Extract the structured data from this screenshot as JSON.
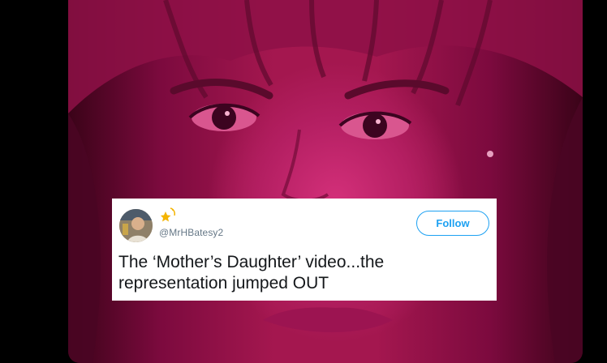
{
  "tweet": {
    "handle": "@MrHBatesy2",
    "follow_label": "Follow",
    "text": "The ‘Mother’s Daughter’ video...the representation jumped OUT",
    "accent_color": "#1da1f2"
  },
  "background": {
    "tint_color": "#b41f62"
  }
}
